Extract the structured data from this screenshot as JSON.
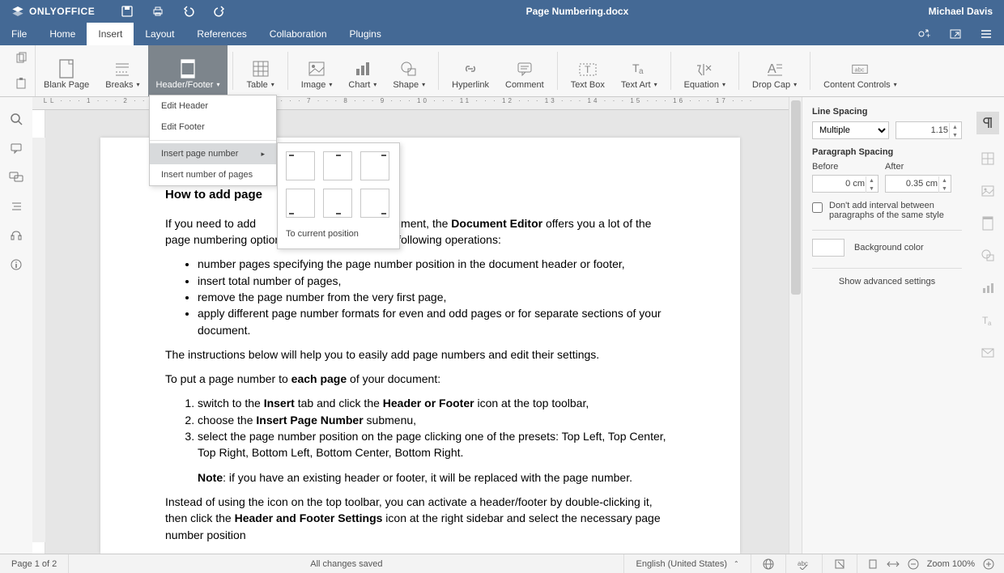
{
  "app": {
    "name": "ONLYOFFICE",
    "doc_title": "Page Numbering.docx",
    "user": "Michael Davis"
  },
  "menus": {
    "file": "File",
    "home": "Home",
    "insert": "Insert",
    "layout": "Layout",
    "references": "References",
    "collaboration": "Collaboration",
    "plugins": "Plugins"
  },
  "ribbon": {
    "blank_page": "Blank Page",
    "breaks": "Breaks",
    "header_footer": "Header/Footer",
    "table": "Table",
    "image": "Image",
    "chart": "Chart",
    "shape": "Shape",
    "hyperlink": "Hyperlink",
    "comment": "Comment",
    "text_box": "Text Box",
    "text_art": "Text Art",
    "equation": "Equation",
    "drop_cap": "Drop Cap",
    "content_controls": "Content Controls"
  },
  "dropdown": {
    "edit_header": "Edit Header",
    "edit_footer": "Edit Footer",
    "insert_page_number": "Insert page number",
    "insert_number_of_pages": "Insert number of pages",
    "to_current_position": "To current position"
  },
  "right_panel": {
    "line_spacing": "Line Spacing",
    "mode": "Multiple",
    "value": "1.15",
    "paragraph_spacing": "Paragraph Spacing",
    "before": "Before",
    "after": "After",
    "before_val": "0 cm",
    "after_val": "0.35 cm",
    "dont_add": "Don't add interval between paragraphs of the same style",
    "bg_color": "Background color",
    "adv": "Show advanced settings"
  },
  "status": {
    "page": "Page 1 of 2",
    "saved": "All changes saved",
    "lang": "English (United States)",
    "zoom": "Zoom 100%"
  },
  "doc": {
    "title": "How to add page",
    "p1a": "If you need to add",
    "p1b": "ument, the ",
    "p1c": "Document Editor",
    "p1d": " offers you a lot of the page numbering options. You can perform the following operations:",
    "b1": "number pages specifying the page number position in the document header or footer,",
    "b2": "insert total number of pages,",
    "b3": "remove the page number from the very first page,",
    "b4": "apply different page number formats for even and odd pages or for separate sections of your document.",
    "p2": "The instructions below will help you to easily add page numbers and edit their settings.",
    "p3a": "To put a page number to ",
    "p3b": "each page",
    "p3c": " of your document:",
    "o1a": "switch to the ",
    "o1b": "Insert",
    "o1c": " tab and click the ",
    "o1d": "Header or Footer",
    "o1e": " icon at the top toolbar,",
    "o2a": "choose the ",
    "o2b": "Insert Page Number",
    "o2c": " submenu,",
    "o3": "select the page number position on the page clicking one of the presets: Top Left, Top Center, Top Right, Bottom Left, Bottom Center, Bottom Right.",
    "note_a": "Note",
    "note_b": ": if you have an existing header or footer, it will be replaced with the page number.",
    "p4a": "Instead of using the icon on the top toolbar, you can activate a header/footer by double-clicking it, then click the ",
    "p4b": "Header and Footer Settings",
    "p4c": "  icon at the right sidebar and select the necessary page number position"
  },
  "hruler": "L · · · 1 · · · 2 · · · 3 · · · 4 · · · 5 · · · 6 · · · 7 · · · 8 · · · 9 · · · 10 · · · 11 · · · 12 · · · 13 · · · 14 · · · 15 · · · 16 · · · 17 · · ·"
}
